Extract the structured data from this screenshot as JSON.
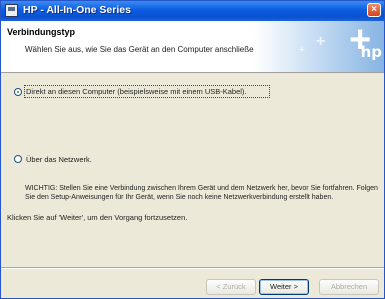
{
  "window": {
    "title": "HP - All-In-One Series",
    "close_label": "×"
  },
  "header": {
    "title": "Verbindungstyp",
    "subtitle": "Wählen Sie aus, wie Sie das Gerät an den Computer anschließen möchten.",
    "logo_text": "hp"
  },
  "options": [
    {
      "label": "Direkt an diesen Computer (beispielsweise mit einem USB-Kabel).",
      "selected": true
    },
    {
      "label": "Über das Netzwerk.",
      "selected": false
    }
  ],
  "warning_text": "WICHTIG: Stellen Sie eine Verbindung zwischen Ihrem Gerät und dem Netzwerk her, bevor Sie fortfahren. Folgen Sie den Setup-Anweisungen für Ihr Gerät, wenn Sie noch keine Netzwerkverbindung erstellt haben.",
  "instruction_text": "Klicken Sie auf 'Weiter', um den Vorgang fortzusetzen.",
  "buttons": {
    "back": "< Zurück",
    "next": "Weiter >",
    "cancel": "Abbrechen"
  }
}
